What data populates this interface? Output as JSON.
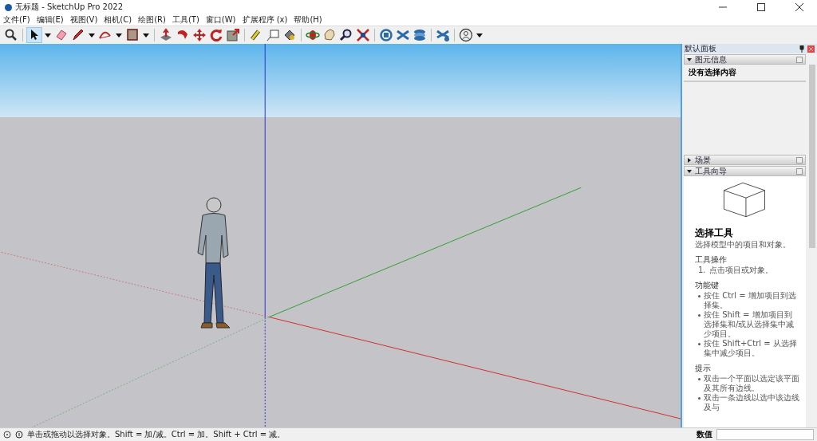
{
  "window": {
    "title": "无标题 - SketchUp Pro 2022"
  },
  "menu": [
    "文件(F)",
    "编辑(E)",
    "视图(V)",
    "相机(C)",
    "绘图(R)",
    "工具(T)",
    "窗口(W)",
    "扩展程序 (x)",
    "帮助(H)"
  ],
  "toolbar": [
    [
      {
        "kind": "search",
        "selected": false,
        "dropdown": false
      }
    ],
    [
      {
        "kind": "select",
        "selected": true,
        "dropdown": true
      },
      {
        "kind": "eraser",
        "selected": false,
        "dropdown": false
      },
      {
        "kind": "pencil",
        "selected": false,
        "dropdown": true
      },
      {
        "kind": "arc",
        "selected": false,
        "dropdown": true
      },
      {
        "kind": "rectangle",
        "selected": false,
        "dropdown": true
      }
    ],
    [
      {
        "kind": "pushpull",
        "selected": false,
        "dropdown": false
      },
      {
        "kind": "followme",
        "selected": false,
        "dropdown": false
      },
      {
        "kind": "move",
        "selected": false,
        "dropdown": false
      },
      {
        "kind": "rotate",
        "selected": false,
        "dropdown": false
      },
      {
        "kind": "scale",
        "selected": false,
        "dropdown": false
      }
    ],
    [
      {
        "kind": "tape",
        "selected": false,
        "dropdown": false
      },
      {
        "kind": "text",
        "selected": false,
        "dropdown": false
      },
      {
        "kind": "paint",
        "selected": false,
        "dropdown": false
      }
    ],
    [
      {
        "kind": "orbit",
        "selected": false,
        "dropdown": false
      },
      {
        "kind": "pan",
        "selected": false,
        "dropdown": false
      },
      {
        "kind": "zoom",
        "selected": false,
        "dropdown": false
      },
      {
        "kind": "zoomext",
        "selected": false,
        "dropdown": false
      }
    ],
    [
      {
        "kind": "warehouse",
        "selected": false,
        "dropdown": false
      },
      {
        "kind": "extwarehouse",
        "selected": false,
        "dropdown": false
      },
      {
        "kind": "layers",
        "selected": false,
        "dropdown": false
      }
    ],
    [
      {
        "kind": "extmanager",
        "selected": false,
        "dropdown": false
      }
    ],
    [
      {
        "kind": "account",
        "selected": false,
        "dropdown": true
      }
    ]
  ],
  "tray": {
    "title": "默认面板",
    "sections": [
      {
        "title": "图元信息",
        "expanded": true
      },
      {
        "title": "场景",
        "expanded": false
      },
      {
        "title": "工具向导",
        "expanded": true
      }
    ],
    "entity_info": "没有选择内容",
    "instructor": {
      "heading": "选择工具",
      "intro": "选择模型中的项目和对象。",
      "blocks": [
        {
          "title": "工具操作",
          "kind": "numbered",
          "items": [
            {
              "number": "1.",
              "text": "点击项目或对象。"
            }
          ]
        },
        {
          "title": "功能键",
          "kind": "bullets",
          "items": [
            "按住 Ctrl = 增加项目到选择集。",
            "按住 Shift = 增加项目到选择集和/或从选择集中减少项目。",
            "按住 Shift+Ctrl = 从选择集中减少项目。"
          ]
        },
        {
          "title": "提示",
          "kind": "bullets",
          "items": [
            "双击一个平面以选定该平面及其所有边线。",
            "双击一条边线以选中该边线及与"
          ]
        }
      ]
    }
  },
  "status_bar": {
    "message": "单击或拖动以选择对象。Shift = 加/减。Ctrl = 加。Shift + Ctrl = 减。",
    "measurements_label": "数值"
  }
}
